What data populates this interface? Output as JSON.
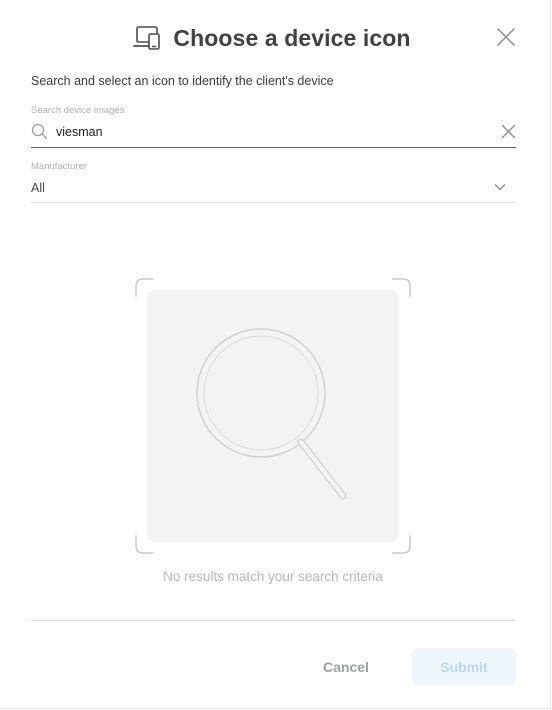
{
  "dialog": {
    "title": "Choose a device icon",
    "subtitle": "Search and select an icon to identify the client's device",
    "header_icon": "devices-icon",
    "close_icon": "close-icon"
  },
  "search": {
    "label": "Search device images",
    "value": "viesman",
    "icon": "search-icon",
    "clear_icon": "clear-icon"
  },
  "manufacturer": {
    "label": "Manufacturer",
    "selected": "All",
    "icon": "chevron-down-icon"
  },
  "results": {
    "empty_message": "No results match your search criteria",
    "empty_icon": "magnifier-illustration"
  },
  "footer": {
    "cancel_label": "Cancel",
    "submit_label": "Submit"
  },
  "colors": {
    "accent": "#2f6f84",
    "title": "#3e4147",
    "submit_bg_disabled": "#f0f7fc",
    "submit_text_disabled": "#b5d6ee"
  }
}
